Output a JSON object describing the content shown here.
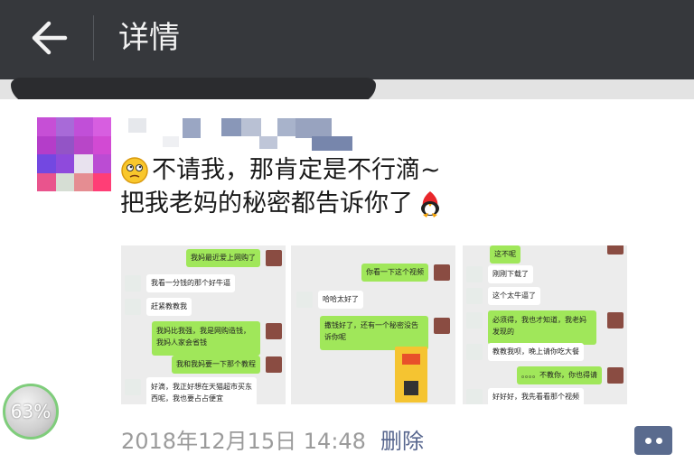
{
  "header": {
    "title": "详情"
  },
  "post": {
    "line1": "不请我，那肯定是不行滴~",
    "line2": "把我老妈的秘密都告诉你了",
    "time": "2018年12月15日 14:48",
    "delete_label": "删除"
  },
  "photo1": {
    "msg1": "我妈最近爱上网购了",
    "msg2": "我看一分钱的那个好牛逼",
    "msg3": "赶紧教教我",
    "msg4": "我妈比我强，我是网购造钱，我妈人家会省钱",
    "msg5": "我和我妈要一下那个教程",
    "msg6": "好滴，我正好想在天猫超市买东西呢，我也要占占便宜"
  },
  "photo2": {
    "msg1": "你看一下这个视频",
    "msg2": "哈哈太好了",
    "msg3": "撒钱好了，还有一个秘密没告诉你呢"
  },
  "photo3": {
    "msg1": "这不呢",
    "msg2": "刚刚下载了",
    "msg3": "这个太牛逼了",
    "msg4": "必须得，我也才知道，我老妈发现的",
    "msg5": "教教我呗，晚上请你吃大餐",
    "msg6": "。。。。不教你，你也得请",
    "msg7": "好好好，我先看看那个视频"
  },
  "progress": {
    "label": "63%",
    "value": 0.63
  },
  "colors": {
    "topbar": "#36383c",
    "link": "#57668e",
    "wechat_green": "#a0e75a"
  }
}
